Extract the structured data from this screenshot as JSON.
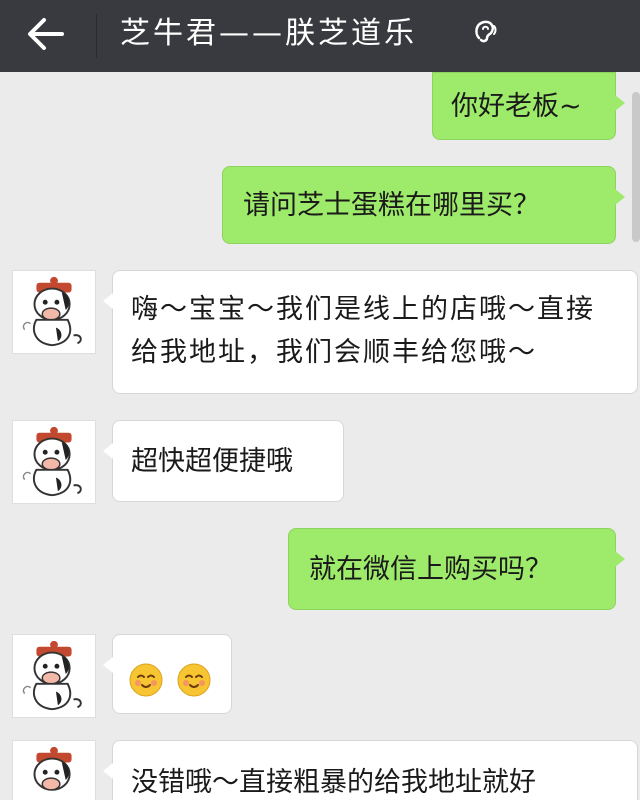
{
  "header": {
    "title": "芝牛君——朕芝道乐",
    "back_icon": "arrow-left-icon",
    "voice_icon": "ear-icon"
  },
  "colors": {
    "header_bg": "#393a3f",
    "chat_bg": "#ebebeb",
    "outgoing_bubble": "#9eea6a",
    "incoming_bubble": "#ffffff"
  },
  "messages": [
    {
      "direction": "out",
      "text": "你好老板~"
    },
    {
      "direction": "out",
      "text": "请问芝士蛋糕在哪里买？"
    },
    {
      "direction": "in",
      "text": "嗨～宝宝～我们是线上的店哦～直接给我地址，我们会顺丰给您哦～"
    },
    {
      "direction": "in",
      "text": "超快超便捷哦"
    },
    {
      "direction": "out",
      "text": "就在微信上购买吗？"
    },
    {
      "direction": "in",
      "emoji": [
        "smiling-face-emoji",
        "smiling-face-emoji"
      ]
    },
    {
      "direction": "in",
      "text": "没错哦～直接粗暴的给我地址就好"
    }
  ]
}
